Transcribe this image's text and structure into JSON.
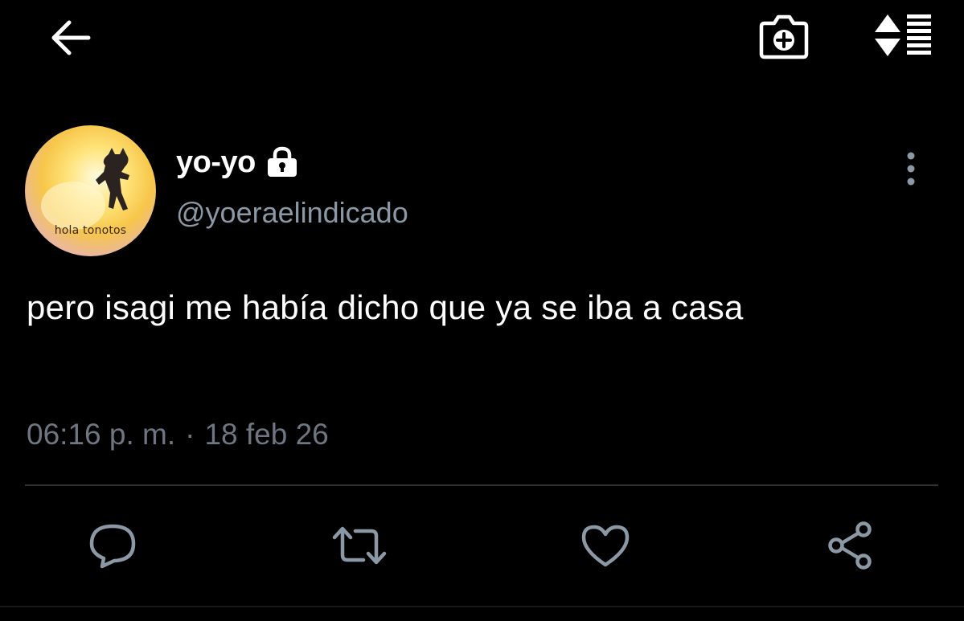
{
  "topbar": {
    "back_icon": "arrow-left-icon",
    "camera_icon": "camera-plus-icon",
    "sort_icon": "sort-arrows-icon"
  },
  "profile": {
    "avatar_caption": "hola tonotos",
    "display_name": "yo-yo",
    "protected_icon": "lock-icon",
    "handle": "@yoeraelindicado",
    "more_icon": "vertical-dots-icon"
  },
  "tweet": {
    "text": "pero isagi me había dicho que ya se iba a casa",
    "time": "06:16 p. m.",
    "separator": "·",
    "date": "18 feb 26"
  },
  "actions": {
    "reply_icon": "reply-bubble-icon",
    "retweet_icon": "retweet-icon",
    "like_icon": "heart-icon",
    "share_icon": "share-icon"
  },
  "colors": {
    "background": "#000000",
    "text_primary": "#ffffff",
    "text_secondary": "#8b98a5",
    "divider": "#2f3336"
  }
}
